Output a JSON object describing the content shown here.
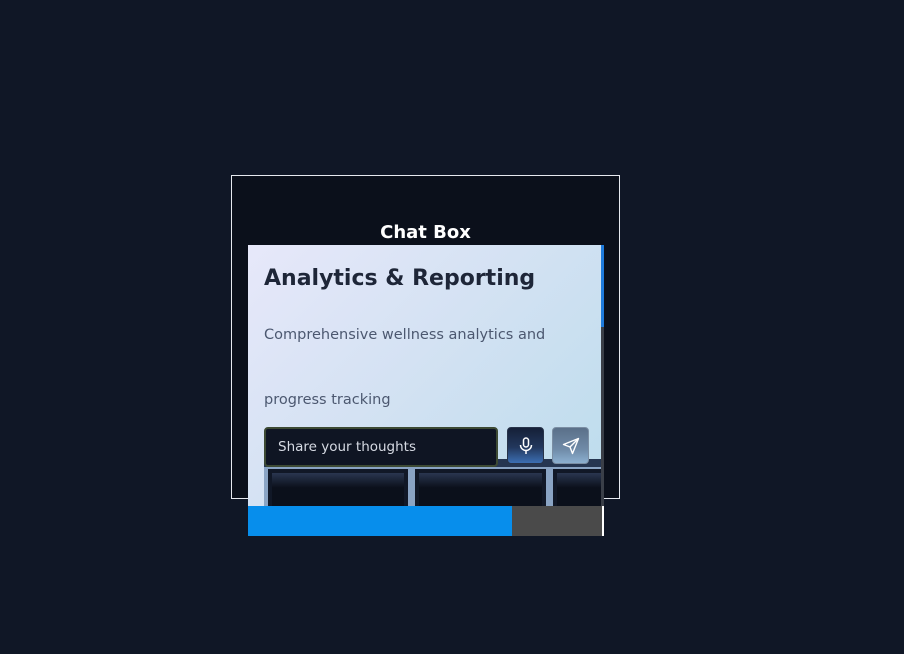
{
  "chat": {
    "title": "Chat Box"
  },
  "card": {
    "heading": "Analytics & Reporting",
    "description_line_1": "Comprehensive wellness analytics and",
    "description_line_2": "progress tracking"
  },
  "composer": {
    "input_value": "Share your thoughts",
    "mic_icon": "microphone-icon",
    "send_icon": "send-icon"
  },
  "progress": {
    "fraction": 0.745
  },
  "colors": {
    "page_background": "#101726",
    "accent": "#078eec"
  }
}
